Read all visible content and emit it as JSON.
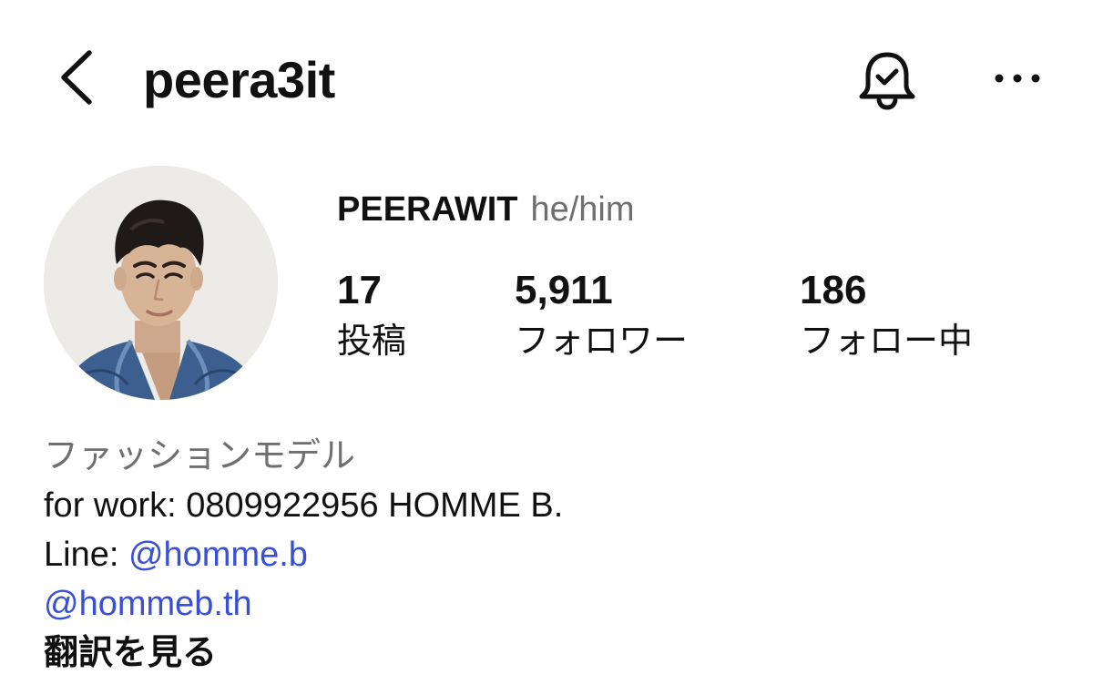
{
  "header": {
    "back_icon": "chevron-left-icon",
    "username": "peera3it",
    "notification_icon": "bell-check-icon",
    "more_icon": "more-horizontal-icon"
  },
  "profile": {
    "avatar": "profile-photo",
    "display_name": "PEERAWIT",
    "pronouns": "he/him"
  },
  "stats": [
    {
      "count": "17",
      "label": "投稿"
    },
    {
      "count": "5,911",
      "label": "フォロワー"
    },
    {
      "count": "186",
      "label": "フォロー中"
    }
  ],
  "bio": {
    "category": "ファッションモデル",
    "line1": "for work: 0809922956 HOMME B.",
    "line2_prefix": "Line: ",
    "line2_link": "@homme.b",
    "line3_link": "@hommeb.th",
    "translate": "翻訳を見る"
  },
  "colors": {
    "text": "#111111",
    "secondary": "#6f6f6f",
    "link": "#3950d6",
    "background": "#ffffff"
  }
}
